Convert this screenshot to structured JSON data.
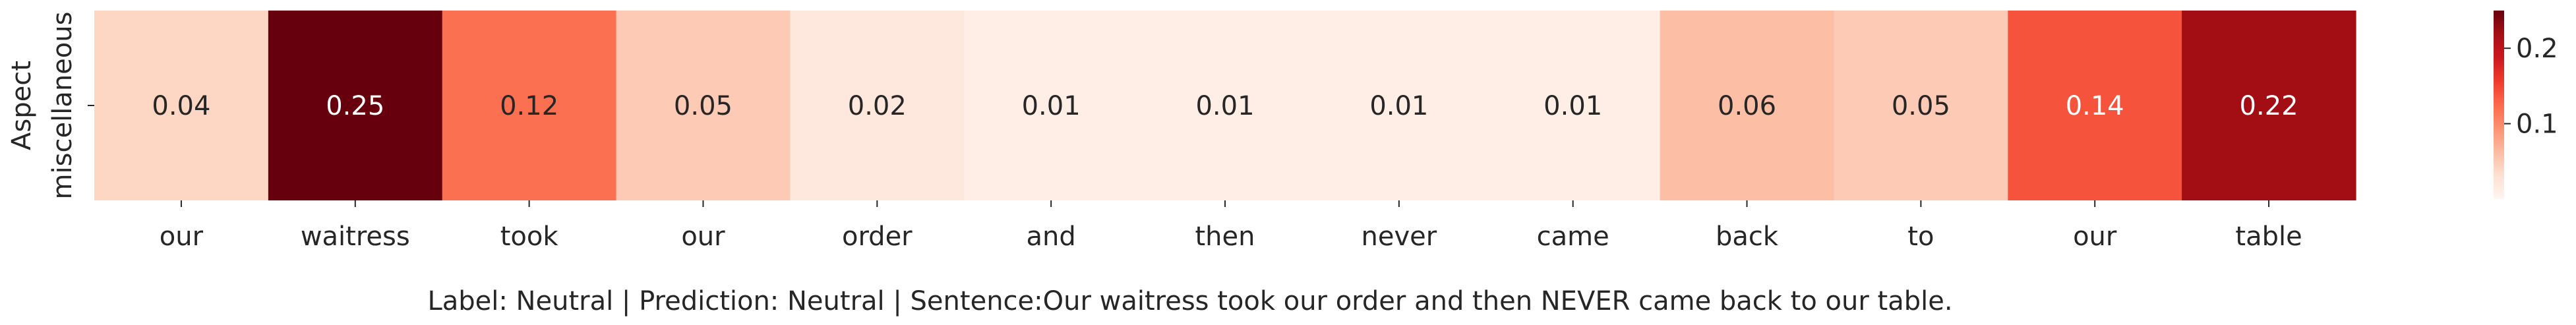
{
  "chart_data": {
    "type": "heatmap",
    "title": "",
    "ylabel": "Aspect",
    "y_categories": [
      "miscellaneous"
    ],
    "x_categories": [
      "our",
      "waitress",
      "took",
      "our",
      "order",
      "and",
      "then",
      "never",
      "came",
      "back",
      "to",
      "our",
      "table"
    ],
    "values": [
      [
        0.04,
        0.25,
        0.12,
        0.05,
        0.02,
        0.01,
        0.01,
        0.01,
        0.01,
        0.06,
        0.05,
        0.14,
        0.22
      ]
    ],
    "value_labels": [
      "0.04",
      "0.25",
      "0.12",
      "0.05",
      "0.02",
      "0.01",
      "0.01",
      "0.01",
      "0.01",
      "0.06",
      "0.05",
      "0.14",
      "0.22"
    ],
    "colorscale": "Reds",
    "colorbar": {
      "range": [
        0.0,
        0.25
      ],
      "ticks": [
        0.1,
        0.2
      ],
      "tick_labels": [
        "0.1",
        "0.2"
      ]
    },
    "caption": "Label: Neutral | Prediction: Neutral | Sentence:Our waitress took our order and then NEVER came back to our table."
  }
}
